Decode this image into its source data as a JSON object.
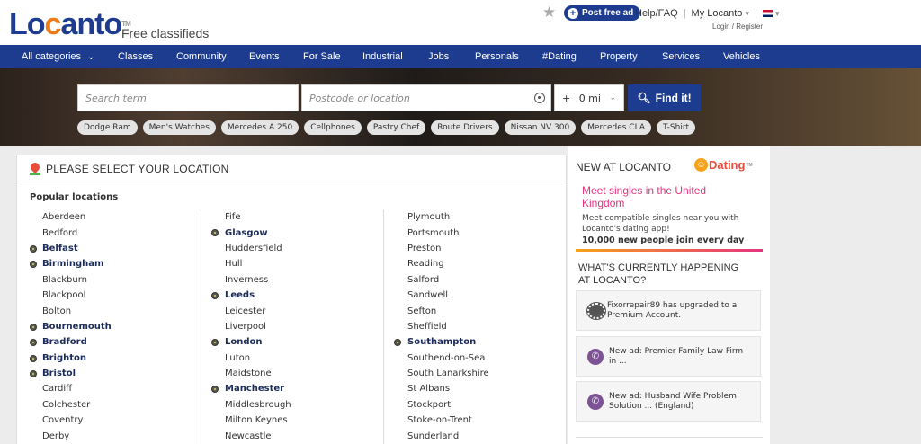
{
  "header": {
    "logo_part1": "Lo",
    "logo_part2": "c",
    "logo_part3": "anto",
    "logo_tm": "TM",
    "tagline": "Free classifieds",
    "post_label": "Post free ad",
    "help_label": "Help/FAQ",
    "account_label": "My Locanto",
    "login_label": "Login",
    "register_label": "Register"
  },
  "nav": {
    "items": [
      "All categories",
      "Classes",
      "Community",
      "Events",
      "For Sale",
      "Industrial",
      "Jobs",
      "Personals",
      "#Dating",
      "Property",
      "Services",
      "Vehicles"
    ]
  },
  "search": {
    "term_placeholder": "Search term",
    "location_placeholder": "Postcode or location",
    "radius_prefix": "+",
    "radius_value": "0 mi",
    "find_label": "Find it!",
    "tags": [
      "Dodge Ram",
      "Men's Watches",
      "Mercedes A 250",
      "Cellphones",
      "Pastry Chef",
      "Route Drivers",
      "Nissan NV 300",
      "Mercedes CLA",
      "T-Shirt"
    ]
  },
  "locations": {
    "title": "PLEASE SELECT YOUR LOCATION",
    "popular_label": "Popular locations",
    "col1": [
      {
        "name": "Aberdeen",
        "featured": false
      },
      {
        "name": "Bedford",
        "featured": false
      },
      {
        "name": "Belfast",
        "featured": true
      },
      {
        "name": "Birmingham",
        "featured": true
      },
      {
        "name": "Blackburn",
        "featured": false
      },
      {
        "name": "Blackpool",
        "featured": false
      },
      {
        "name": "Bolton",
        "featured": false
      },
      {
        "name": "Bournemouth",
        "featured": true
      },
      {
        "name": "Bradford",
        "featured": true
      },
      {
        "name": "Brighton",
        "featured": true
      },
      {
        "name": "Bristol",
        "featured": true
      },
      {
        "name": "Cardiff",
        "featured": false
      },
      {
        "name": "Colchester",
        "featured": false
      },
      {
        "name": "Coventry",
        "featured": false
      },
      {
        "name": "Derby",
        "featured": false
      }
    ],
    "col2": [
      {
        "name": "Fife",
        "featured": false
      },
      {
        "name": "Glasgow",
        "featured": true
      },
      {
        "name": "Huddersfield",
        "featured": false
      },
      {
        "name": "Hull",
        "featured": false
      },
      {
        "name": "Inverness",
        "featured": false
      },
      {
        "name": "Leeds",
        "featured": true
      },
      {
        "name": "Leicester",
        "featured": false
      },
      {
        "name": "Liverpool",
        "featured": false
      },
      {
        "name": "London",
        "featured": true
      },
      {
        "name": "Luton",
        "featured": false
      },
      {
        "name": "Maidstone",
        "featured": false
      },
      {
        "name": "Manchester",
        "featured": true
      },
      {
        "name": "Middlesbrough",
        "featured": false
      },
      {
        "name": "Milton Keynes",
        "featured": false
      },
      {
        "name": "Newcastle",
        "featured": false
      }
    ],
    "col3": [
      {
        "name": "Plymouth",
        "featured": false
      },
      {
        "name": "Portsmouth",
        "featured": false
      },
      {
        "name": "Preston",
        "featured": false
      },
      {
        "name": "Reading",
        "featured": false
      },
      {
        "name": "Salford",
        "featured": false
      },
      {
        "name": "Sandwell",
        "featured": false
      },
      {
        "name": "Sefton",
        "featured": false
      },
      {
        "name": "Sheffield",
        "featured": false
      },
      {
        "name": "Southampton",
        "featured": true
      },
      {
        "name": "Southend-on-Sea",
        "featured": false
      },
      {
        "name": "South Lanarkshire",
        "featured": false
      },
      {
        "name": "St Albans",
        "featured": false
      },
      {
        "name": "Stockport",
        "featured": false
      },
      {
        "name": "Stoke-on-Trent",
        "featured": false
      },
      {
        "name": "Sunderland",
        "featured": false
      }
    ]
  },
  "sidebar": {
    "new_heading": "NEW AT LOCANTO",
    "dating_logo": "Dating",
    "dating_logo_tm": "TM",
    "dating_headline": "Meet singles in the United Kingdom",
    "dating_sub": "Meet compatible singles near you with Locanto's dating app!",
    "dating_count": "10,000 new people join every day",
    "happening_line1": "WHAT'S CURRENTLY HAPPENING",
    "happening_line2": "AT LOCANTO?",
    "feed": [
      {
        "text": "Fixorrepair89 has upgraded to a Premium Account."
      },
      {
        "text": "New ad: Premier Family Law Firm in ..."
      },
      {
        "text": "New ad: Husband Wife Problem Solution ... (England)"
      }
    ]
  },
  "colors": {
    "brand_blue": "#1d3c8f",
    "brand_orange": "#f07b16",
    "dating_pink": "#e5337f"
  }
}
